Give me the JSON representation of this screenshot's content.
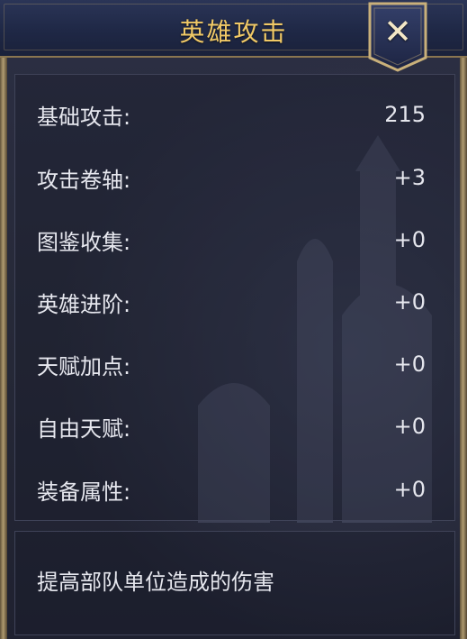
{
  "header": {
    "title": "英雄攻击",
    "close_icon": "close-x-icon"
  },
  "stats": [
    {
      "label": "基础攻击:",
      "value": "215"
    },
    {
      "label": "攻击卷轴:",
      "value": "+3"
    },
    {
      "label": "图鉴收集:",
      "value": "+0"
    },
    {
      "label": "英雄进阶:",
      "value": "+0"
    },
    {
      "label": "天赋加点:",
      "value": "+0"
    },
    {
      "label": "自由天赋:",
      "value": "+0"
    },
    {
      "label": "装备属性:",
      "value": "+0"
    }
  ],
  "description": "提高部队单位造成的伤害",
  "colors": {
    "title": "#f1c966",
    "frame_gold": "#c9b07a",
    "text": "#e6e7ee",
    "header_bg": "#1f2846"
  }
}
